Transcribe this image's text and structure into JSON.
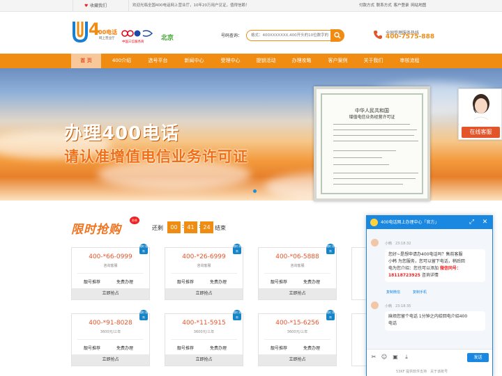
{
  "topbar": {
    "favorite": "收藏我们",
    "welcome": "欢迎光临全国400电话网上营业厅，10年20万用户见证，值得信赖！",
    "links": "付款方式 联系方式 客户登录 网站地图"
  },
  "header": {
    "logo_4": "4",
    "logo_00": "00电话",
    "logo_sub": "网上营业厅",
    "unicom_label": "中国三信服务商",
    "city": "北京",
    "query_label": "号码查询：",
    "query_placeholder": "格式：400XXXXXXX,400开头的10位数字的",
    "hotline_label": "全国受理服务热线",
    "hotline_number": "400-7575-888"
  },
  "nav": [
    {
      "label": "首 页",
      "active": true
    },
    {
      "label": "400介绍",
      "active": false
    },
    {
      "label": "选号平台",
      "active": false
    },
    {
      "label": "新闻中心",
      "active": false
    },
    {
      "label": "受理中心",
      "active": false
    },
    {
      "label": "提钥活动",
      "active": false
    },
    {
      "label": "办理攻略",
      "active": false
    },
    {
      "label": "客户案例",
      "active": false
    },
    {
      "label": "关于我们",
      "active": false
    },
    {
      "label": "审核流程",
      "active": false
    }
  ],
  "banner": {
    "title": "办理400电话",
    "subtitle": "请认准增值电信业务许可证",
    "cert_title": "中华人民共和国",
    "cert_subtitle": "增值电信业务经营许可证"
  },
  "cs_float": {
    "button": "在线客服"
  },
  "promo": {
    "title": "限时抢购",
    "tag": "秒杀",
    "countdown_prefix": "还剩",
    "hours": "00",
    "minutes": "41",
    "seconds": "24",
    "countdown_suffix": "结束",
    "cards": [
      {
        "number": "400-*66-0999",
        "desc": "咨询客服",
        "a1": "靓号推荐",
        "a2": "免费办理",
        "buy": "立即抢占",
        "badge": "限时 抢购"
      },
      {
        "number": "400-*26-6999",
        "desc": "咨询客服",
        "a1": "靓号推荐",
        "a2": "免费办理",
        "buy": "立即抢占",
        "badge": "限时 抢购"
      },
      {
        "number": "400-*06-5888",
        "desc": "咨询客服",
        "a1": "靓号推荐",
        "a2": "免费办理",
        "buy": "立即抢占",
        "badge": "限时 抢购"
      },
      {
        "number": "400-*91-8028",
        "desc": "3600元/三年",
        "a1": "靓号推荐",
        "a2": "免费办理",
        "buy": "立即抢占",
        "badge": "限时 抢购"
      },
      {
        "number": "400-*11-5915",
        "desc": "3600元/三年",
        "a1": "靓号推荐",
        "a2": "免费办理",
        "buy": "立即抢占",
        "badge": "限时 抢购"
      },
      {
        "number": "400-*15-6256",
        "desc": "3600元/三年",
        "a1": "靓号推荐",
        "a2": "免费办理",
        "buy": "立即抢占",
        "badge": "限时 抢购"
      }
    ]
  },
  "chat": {
    "title": "400电话网上办理中心「官方」",
    "msg1_meta": "小韩　23:18:32",
    "msg1_line1": "您好~是想申请办400电话吗？售前客服",
    "msg1_line2": "小韩 为您服务，您可以留下电话，稍后回",
    "msg1_line3": "电为您介绍：您也可以添加",
    "msg1_highlight1": "微信同号：",
    "msg1_highlight2": "18118723925",
    "msg1_line4": "咨询详情",
    "copy_wechat": "复制微信",
    "copy_phone": "复制手机",
    "msg2_meta": "小韩　23:18:35",
    "msg2_line1": "麻烦您留个电话 1分钟之内给回电介绍400",
    "msg2_line2": "电话",
    "send": "发送",
    "powered": "53KF 提供软件支持　关于该账号"
  },
  "colors": {
    "accent": "#f08c12",
    "nav_active_bg": "#f9c89a",
    "chat_blue": "#1a88e0",
    "price_red": "#e4542a"
  }
}
